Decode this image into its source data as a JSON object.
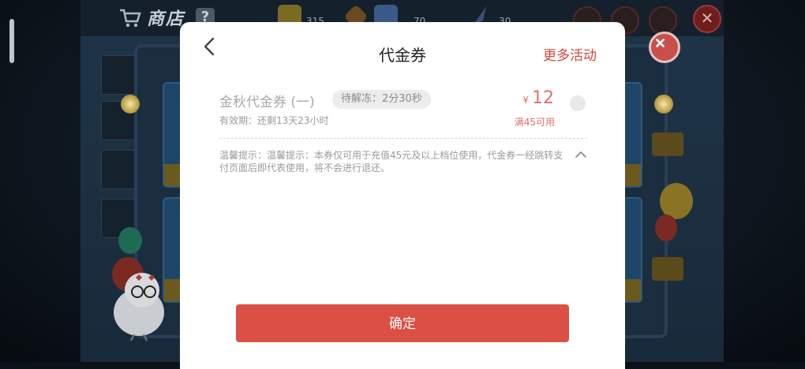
{
  "background": {
    "store_title": "商店",
    "help_badge": "?",
    "resources": [
      {
        "icon": "gold-bar-icon",
        "value": "315"
      },
      {
        "icon": "gem-icon",
        "value": "70"
      },
      {
        "icon": "feather-icon",
        "value": "30"
      }
    ],
    "close_icon": "✕"
  },
  "modal": {
    "title": "代金券",
    "more_link": "更多活动",
    "coupon": {
      "name": "金秋代金券 (一)",
      "badge": "待解冻：2分30秒",
      "validity": "有效期：还剩13天23小时",
      "currency": "¥",
      "amount": "12",
      "condition": "满45可用",
      "selected": false
    },
    "tip": "温馨提示：温馨提示：本券仅可用于充值45元及以上档位使用，代金券一经跳转支付页面后即代表使用，将不会进行退还。",
    "confirm_label": "确定"
  },
  "colors": {
    "accent": "#db5045",
    "price": "#e0716b",
    "close_button": "#c9504a"
  }
}
